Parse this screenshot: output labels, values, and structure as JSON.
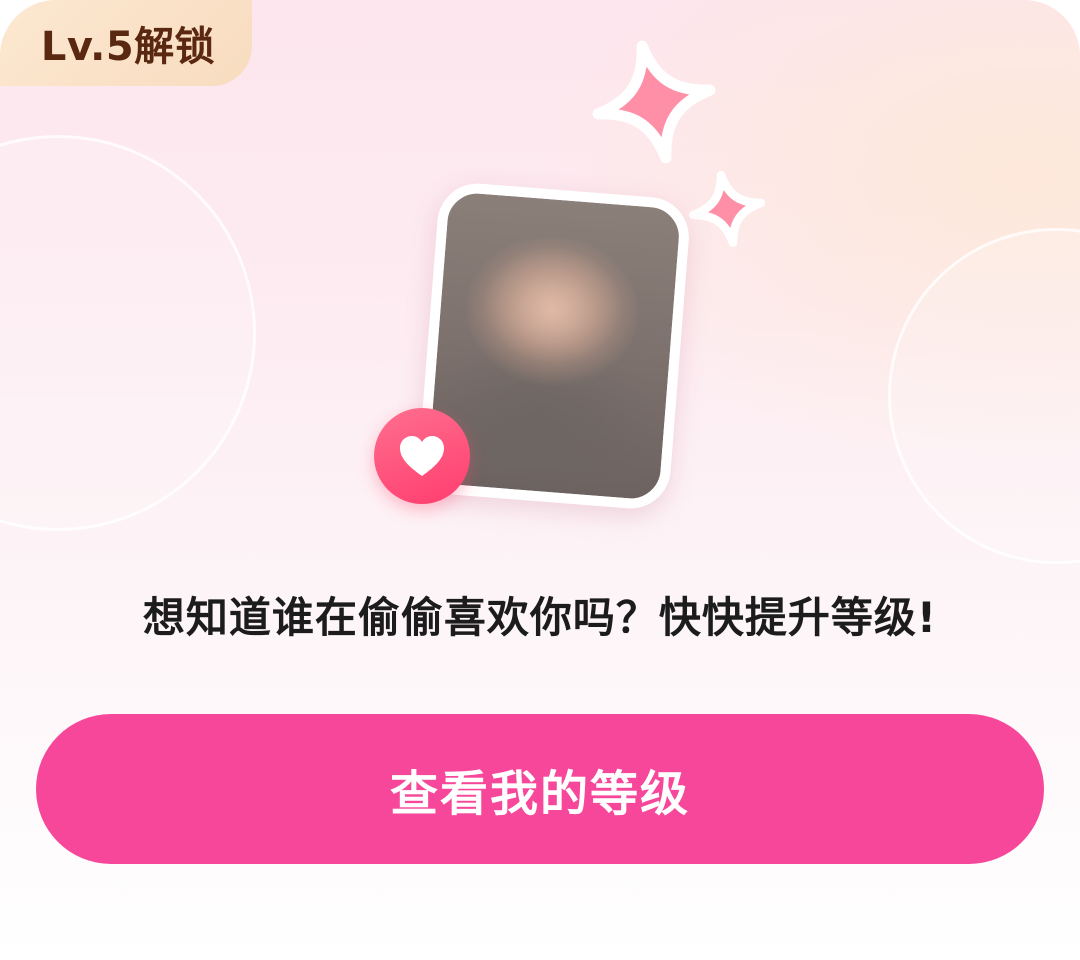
{
  "badge": {
    "label": "Lv.5解锁"
  },
  "icons": {
    "sparkles": "sparkle-icon",
    "heart": "heart-icon",
    "photo": "blurred-profile-photo"
  },
  "message": {
    "text": "想知道谁在偷偷喜欢你吗？快快提升等级!"
  },
  "cta": {
    "label": "查看我的等级"
  },
  "colors": {
    "accent": "#f6479a",
    "heart": "#ff4d76",
    "badge_bg": "#fce8d1",
    "badge_text": "#5a2710",
    "sparkle": "#ff8fa6"
  }
}
